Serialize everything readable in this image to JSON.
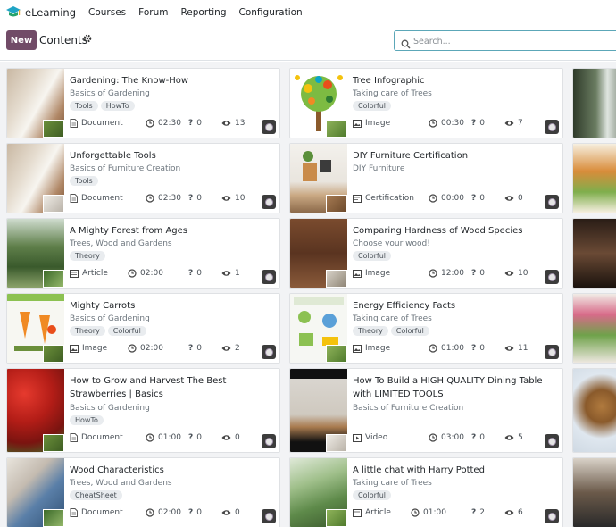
{
  "nav": {
    "app_name": "eLearning",
    "menus": [
      "Courses",
      "Forum",
      "Reporting",
      "Configuration"
    ],
    "logo_icon": "graduation-cap-icon"
  },
  "control_panel": {
    "new_label": "New",
    "breadcrumb": "Contents",
    "search_placeholder": "Search..."
  },
  "colors": {
    "brand": "#714b67",
    "search_border": "#5ca7b8"
  },
  "cards": [
    {
      "title": "Gardening: The Know-How",
      "course": "Basics of Gardening",
      "tags": [
        "Tools",
        "HowTo"
      ],
      "type": "Document",
      "type_icon": "document-icon",
      "duration": "02:30",
      "questions": "0",
      "views": "13"
    },
    {
      "title": "Tree Infographic",
      "course": "Taking care of Trees",
      "tags": [
        "Colorful"
      ],
      "type": "Image",
      "type_icon": "image-icon",
      "duration": "00:30",
      "questions": "0",
      "views": "7"
    },
    {
      "title": "Unforgettable Tools",
      "course": "Basics of Furniture Creation",
      "tags": [
        "Tools"
      ],
      "type": "Document",
      "type_icon": "document-icon",
      "duration": "02:30",
      "questions": "0",
      "views": "10"
    },
    {
      "title": "DIY Furniture Certification",
      "course": "DIY Furniture",
      "tags": [],
      "type": "Certification",
      "type_icon": "certificate-icon",
      "duration": "00:00",
      "questions": "0",
      "views": "0"
    },
    {
      "title": "A Mighty Forest from Ages",
      "course": "Trees, Wood and Gardens",
      "tags": [
        "Theory"
      ],
      "type": "Article",
      "type_icon": "article-icon",
      "duration": "02:00",
      "questions": "0",
      "views": "1"
    },
    {
      "title": "Comparing Hardness of Wood Species",
      "course": "Choose your wood!",
      "tags": [
        "Colorful"
      ],
      "type": "Image",
      "type_icon": "image-icon",
      "duration": "12:00",
      "questions": "0",
      "views": "10"
    },
    {
      "title": "Mighty Carrots",
      "course": "Basics of Gardening",
      "tags": [
        "Theory",
        "Colorful"
      ],
      "type": "Image",
      "type_icon": "image-icon",
      "duration": "02:00",
      "questions": "0",
      "views": "2"
    },
    {
      "title": "Energy Efficiency Facts",
      "course": "Taking care of Trees",
      "tags": [
        "Theory",
        "Colorful"
      ],
      "type": "Image",
      "type_icon": "image-icon",
      "duration": "01:00",
      "questions": "0",
      "views": "11"
    },
    {
      "title": "How to Grow and Harvest The Best Strawberries | Basics",
      "course": "Basics of Gardening",
      "tags": [
        "HowTo"
      ],
      "type": "Document",
      "type_icon": "document-icon",
      "duration": "01:00",
      "questions": "0",
      "views": "0"
    },
    {
      "title": "How To Build a HIGH QUALITY Dining Table with LIMITED TOOLS",
      "course": "Basics of Furniture Creation",
      "tags": [],
      "type": "Video",
      "type_icon": "video-icon",
      "duration": "03:00",
      "questions": "0",
      "views": "5"
    },
    {
      "title": "Wood Characteristics",
      "course": "Trees, Wood and Gardens",
      "tags": [
        "CheatSheet"
      ],
      "type": "Document",
      "type_icon": "document-icon",
      "duration": "02:00",
      "questions": "0",
      "views": "0"
    },
    {
      "title": "A little chat with Harry Potted",
      "course": "Taking care of Trees",
      "tags": [
        "Colorful"
      ],
      "type": "Article",
      "type_icon": "article-icon",
      "duration": "01:00",
      "questions": "2",
      "views": "6"
    }
  ],
  "peek_cards": [
    {
      "thumb": "forest-thumbnail"
    },
    {
      "thumb": "garden-map-thumbnail"
    },
    {
      "thumb": "video-thumbnail"
    },
    {
      "thumb": "plants-thumbnail"
    },
    {
      "thumb": "owl-thumbnail"
    },
    {
      "thumb": "laptop-thumbnail"
    }
  ]
}
